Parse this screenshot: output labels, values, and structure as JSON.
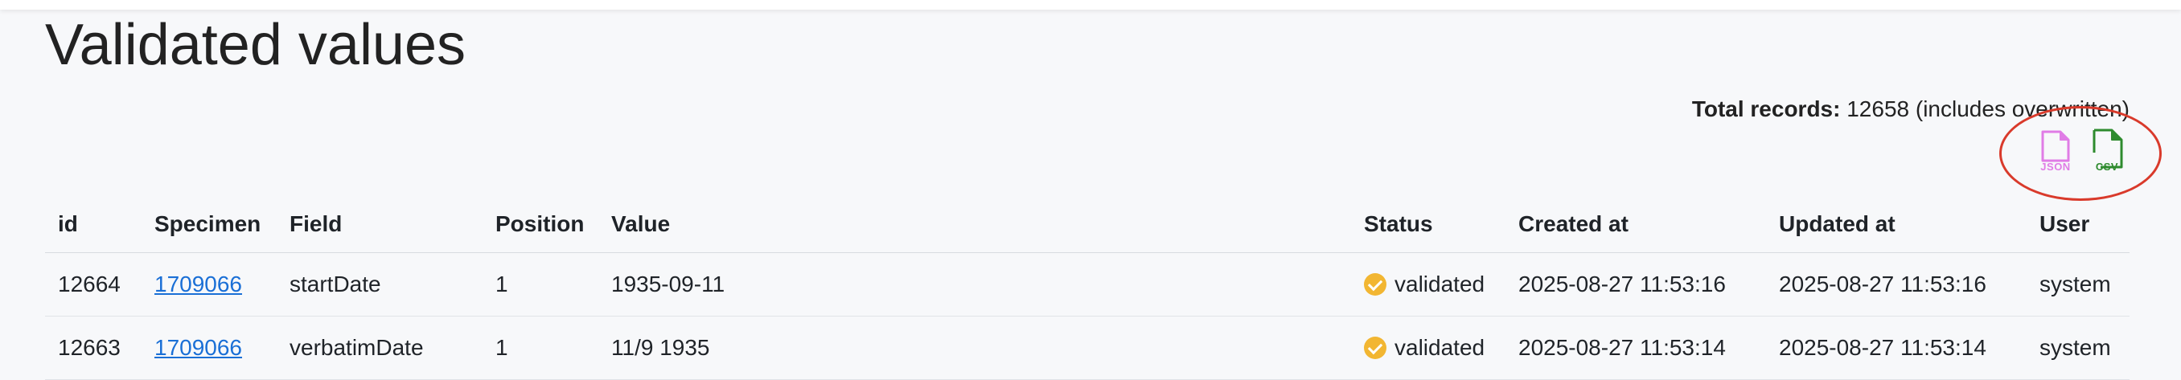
{
  "page": {
    "title": "Validated values"
  },
  "summary": {
    "total_label": "Total records:",
    "total_value": "12658",
    "total_note": "(includes overwritten)"
  },
  "downloads": {
    "json_label": "JSON",
    "csv_label": "CSV",
    "json_color": "#e07ce6",
    "csv_color": "#2e8b2e"
  },
  "annotation": {
    "circle_color": "#d93a2b"
  },
  "table": {
    "headers": [
      "id",
      "Specimen",
      "Field",
      "Position",
      "Value",
      "Status",
      "Created at",
      "Updated at",
      "User"
    ],
    "rows": [
      {
        "id": "12664",
        "specimen": "1709066",
        "field": "startDate",
        "position": "1",
        "value": "1935-09-11",
        "status": "validated",
        "created_at": "2025-08-27 11:53:16",
        "updated_at": "2025-08-27 11:53:16",
        "user": "system"
      },
      {
        "id": "12663",
        "specimen": "1709066",
        "field": "verbatimDate",
        "position": "1",
        "value": "11/9 1935",
        "status": "validated",
        "created_at": "2025-08-27 11:53:14",
        "updated_at": "2025-08-27 11:53:14",
        "user": "system"
      }
    ]
  }
}
